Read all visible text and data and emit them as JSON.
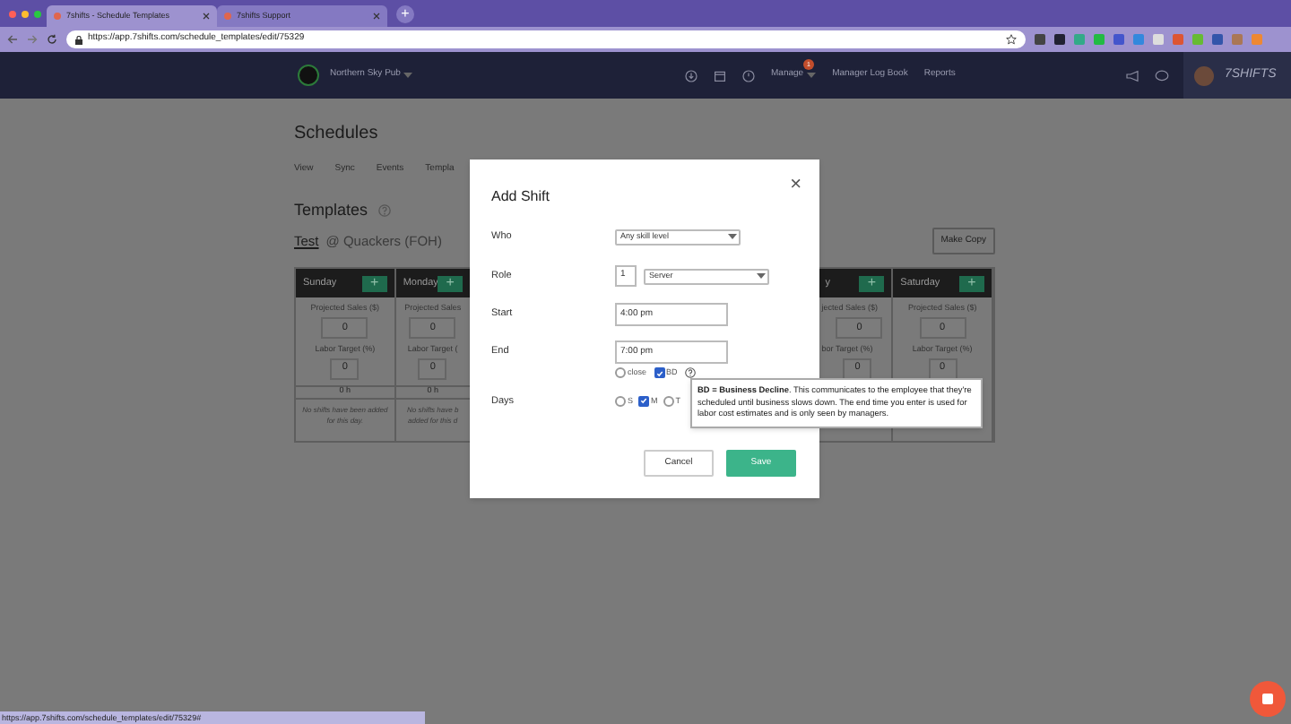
{
  "browser": {
    "tabs": [
      {
        "title": "7shifts - Schedule Templates",
        "selected": true
      },
      {
        "title": "7shifts Support",
        "selected": false
      }
    ],
    "new_tab": "+",
    "url": "https://app.7shifts.com/schedule_templates/edit/75329"
  },
  "nav": {
    "location": "Northern Sky Pub",
    "links": [
      {
        "label": "Manage",
        "badge": "1",
        "dropdown": true
      },
      {
        "label": "Manager Log Book",
        "dropdown": false
      },
      {
        "label": "Reports",
        "dropdown": false
      }
    ],
    "logo": "7SHIFTS"
  },
  "page": {
    "title": "Schedules",
    "subnav": [
      "View",
      "Sync",
      "Events",
      "Templa"
    ],
    "heading": "Templates",
    "template_name": "Test",
    "template_location": "@ Quackers (FOH)",
    "make_copy": "Make Copy",
    "columns": [
      {
        "day": "Sunday",
        "add": "+",
        "sales_label": "Projected Sales ($)",
        "sales": "0",
        "labor_label": "Labor Target (%)",
        "labor": "0",
        "hours": "0 h",
        "note": "No shifts have been added for this day."
      },
      {
        "day": "Monday",
        "add": "+",
        "sales_label": "Projected Sales",
        "sales": "0",
        "labor_label": "Labor Target (",
        "labor": "0",
        "hours": "0 h",
        "note": "No shifts have b added for this d"
      },
      {
        "day": "y",
        "add": "+",
        "sales_label": "jected Sales ($)",
        "sales": "0",
        "labor_label": "bor Target (%)",
        "labor": "0"
      },
      {
        "day": "Saturday",
        "add": "+",
        "sales_label": "Projected Sales ($)",
        "sales": "0",
        "labor_label": "Labor Target (%)",
        "labor": "0"
      }
    ]
  },
  "modal": {
    "title": "Add Shift",
    "close": "×",
    "who_label": "Who",
    "who": "Any skill level",
    "role_label": "Role",
    "role_count": "1",
    "role": "Server",
    "start_label": "Start",
    "start": "4:00 pm",
    "end_label": "End",
    "end": "7:00 pm",
    "end_options": [
      {
        "label": "close",
        "checked": false
      },
      {
        "label": "BD",
        "checked": true
      }
    ],
    "days_label": "Days",
    "days": [
      {
        "label": "S",
        "checked": false
      },
      {
        "label": "M",
        "checked": true
      },
      {
        "label": "T",
        "checked": false
      }
    ],
    "cancel": "Cancel",
    "save": "Save"
  },
  "tooltip": "**BD = Business Decline**. This communicates to the employee that they're scheduled until business slows down. The end time you enter is used for labor cost estimates and is only seen by managers.",
  "status_url": "https://app.7shifts.com/schedule_templates/edit/75329#"
}
